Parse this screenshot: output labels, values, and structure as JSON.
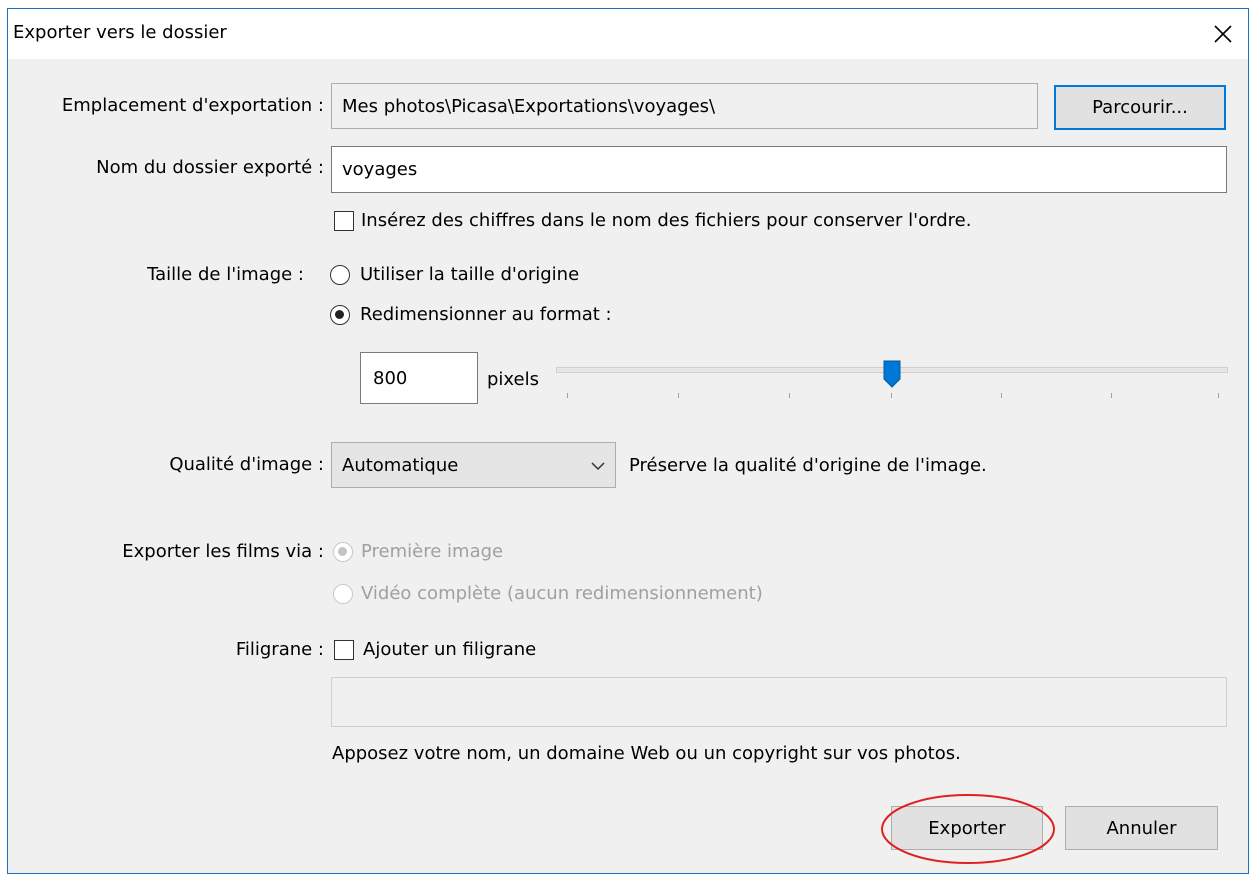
{
  "window": {
    "title": "Exporter vers le dossier"
  },
  "location": {
    "label": "Emplacement d'exportation :",
    "value": "Mes photos\\Picasa\\Exportations\\voyages\\",
    "browse_label": "Parcourir..."
  },
  "folder_name": {
    "label": "Nom du dossier exporté :",
    "value": "voyages"
  },
  "number_files": {
    "label": "Insérez des chiffres dans le nom des fichiers pour conserver l'ordre.",
    "checked": false
  },
  "image_size": {
    "label": "Taille de l'image :",
    "original_label": "Utiliser la taille d'origine",
    "resize_label": "Redimensionner au format :",
    "selected": "resize",
    "pixels_value": "800",
    "pixels_unit": "pixels",
    "slider_fraction": 0.5
  },
  "quality": {
    "label": "Qualité d'image :",
    "selected": "Automatique",
    "description": "Préserve la qualité d'origine de l'image."
  },
  "movies": {
    "label": "Exporter les films via :",
    "first_frame_label": "Première image",
    "full_video_label": "Vidéo complète (aucun redimensionnement)",
    "selected": "first_frame",
    "disabled": true
  },
  "watermark": {
    "label": "Filigrane :",
    "checkbox_label": "Ajouter un filigrane",
    "checked": false,
    "value": "",
    "hint": "Apposez votre nom, un domaine Web ou un copyright sur vos photos."
  },
  "actions": {
    "export_label": "Exporter",
    "cancel_label": "Annuler"
  },
  "colors": {
    "accent": "#0078d7",
    "annotation": "#e02020"
  }
}
